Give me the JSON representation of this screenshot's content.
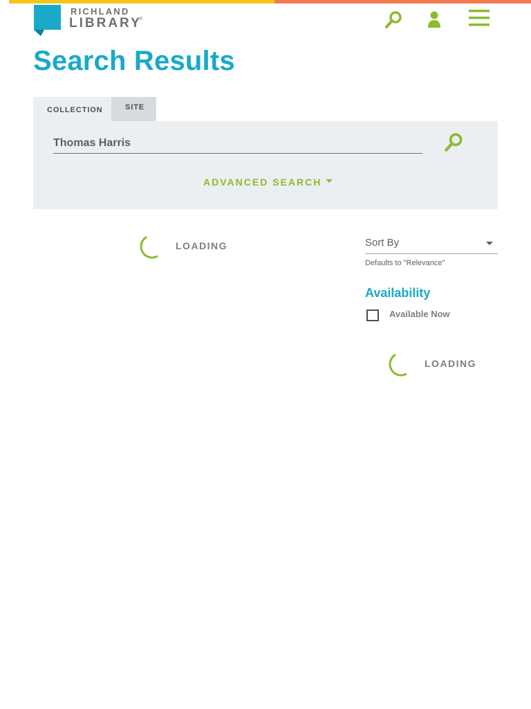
{
  "brand": {
    "logo_line1": "RICHLAND",
    "logo_line2": "LIBRARY",
    "logo_reg": "®",
    "logo_icon": "speech-bubble-logo",
    "accent_blue": "#1aa9c9",
    "accent_green": "#8dbb2e",
    "bar_yellow": "#f5c518",
    "bar_orange": "#f47b4f"
  },
  "header": {
    "icons": [
      "search-icon",
      "user-icon",
      "menu-icon"
    ]
  },
  "page": {
    "title": "Search Results"
  },
  "search": {
    "tabs": [
      {
        "label": "COLLECTION",
        "active": true
      },
      {
        "label": "SITE",
        "active": false
      }
    ],
    "query": "Thomas Harris",
    "advanced_label": "ADVANCED SEARCH"
  },
  "results": {
    "loading_label": "LOADING"
  },
  "sidebar": {
    "sort_label": "Sort By",
    "sort_hint": "Defaults to \"Relevance\"",
    "availability_title": "Availability",
    "available_now_label": "Available Now",
    "available_now_checked": false,
    "loading_label": "LOADING"
  }
}
